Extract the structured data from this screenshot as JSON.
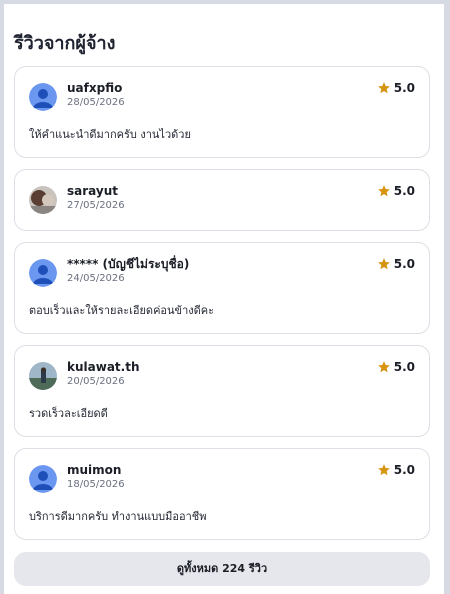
{
  "section": {
    "title": "รีวิวจากผู้จ้าง"
  },
  "reviews": [
    {
      "username": "uafxpfio",
      "date": "28/05/2026",
      "rating": "5.0",
      "comment": "ให้คำแนะนำดีมากครับ งานไวด้วย",
      "avatar": "default-avatar-icon"
    },
    {
      "username": "sarayut",
      "date": "27/05/2026",
      "rating": "5.0",
      "comment": "",
      "avatar": "photo-avatar"
    },
    {
      "username": "***** (บัญชีไม่ระบุชื่อ)",
      "date": "24/05/2026",
      "rating": "5.0",
      "comment": "ตอบเร็วและให้รายละเอียดค่อนข้างดีคะ",
      "avatar": "default-avatar-icon"
    },
    {
      "username": "kulawat.th",
      "date": "20/05/2026",
      "rating": "5.0",
      "comment": "รวดเร็วละเอียดดี",
      "avatar": "photo-avatar"
    },
    {
      "username": "muimon",
      "date": "18/05/2026",
      "rating": "5.0",
      "comment": "บริการดีมากครับ ทำงานแบบมืออาชีพ",
      "avatar": "default-avatar-icon"
    }
  ],
  "footer": {
    "view_all_label": "ดูทั้งหมด 224 รีวิว"
  },
  "colors": {
    "star": "#d69413",
    "avatar_bg": "#5b8def",
    "avatar_fg": "#1e4fb8"
  }
}
